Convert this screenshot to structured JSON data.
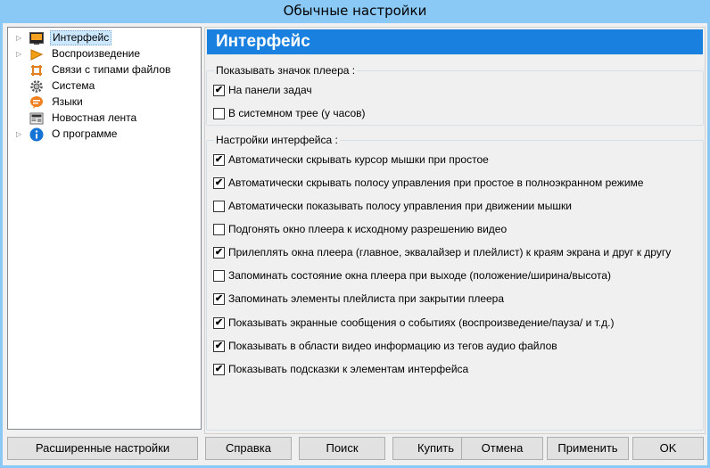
{
  "window": {
    "title": "Обычные настройки"
  },
  "tree": {
    "items": [
      {
        "label": "Интерфейс",
        "icon": "monitor-icon",
        "arrow": "▷",
        "selected": true
      },
      {
        "label": "Воспроизведение",
        "icon": "play-icon",
        "arrow": "▷"
      },
      {
        "label": "Связи с типами файлов",
        "icon": "file-associations-icon",
        "arrow": ""
      },
      {
        "label": "Система",
        "icon": "gear-icon",
        "arrow": ""
      },
      {
        "label": "Языки",
        "icon": "language-icon",
        "arrow": ""
      },
      {
        "label": "Новостная лента",
        "icon": "news-icon",
        "arrow": ""
      },
      {
        "label": "О программе",
        "icon": "info-icon",
        "arrow": "▷"
      }
    ]
  },
  "panel": {
    "title": "Интерфейс"
  },
  "group_tray": {
    "title": "Показывать значок плеера :",
    "options": [
      {
        "label": "На панели задач",
        "checked": true,
        "mark": "✔"
      },
      {
        "label": "В системном трее (у часов)",
        "checked": false,
        "mark": ""
      }
    ]
  },
  "group_interface": {
    "title": "Настройки интерфейса :",
    "options": [
      {
        "label": "Автоматически скрывать курсор мышки при простое",
        "checked": true,
        "mark": "✔"
      },
      {
        "label": "Автоматически скрывать полосу управления при простое в полноэкранном режиме",
        "checked": true,
        "mark": "✔"
      },
      {
        "label": "Автоматически показывать полосу управления при движении мышки",
        "checked": false,
        "mark": ""
      },
      {
        "label": "Подгонять окно плеера к исходному разрешению видео",
        "checked": false,
        "mark": ""
      },
      {
        "label": "Прилеплять окна плеера (главное, эквалайзер и плейлист) к краям экрана и друг к другу",
        "checked": true,
        "mark": "✔"
      },
      {
        "label": "Запоминать состояние окна плеера при выходе (положение/ширина/высота)",
        "checked": false,
        "mark": ""
      },
      {
        "label": "Запоминать элементы плейлиста при закрытии плеера",
        "checked": true,
        "mark": "✔"
      },
      {
        "label": "Показывать экранные сообщения о событиях (воспроизведение/пауза/ и т.д.)",
        "checked": true,
        "mark": "✔"
      },
      {
        "label": "Показывать в области видео информацию из тегов аудио файлов",
        "checked": true,
        "mark": "✔"
      },
      {
        "label": "Показывать подсказки к элементам интерфейса",
        "checked": true,
        "mark": "✔"
      }
    ]
  },
  "buttons": {
    "advanced": "Расширенные настройки",
    "help": "Справка",
    "search": "Поиск",
    "buy": "Купить",
    "cancel": "Отмена",
    "apply": "Применить",
    "ok": "OK"
  },
  "colors": {
    "title_bar": "#8ac8f6",
    "header": "#1a80e0",
    "selection": "#cce8ff"
  }
}
